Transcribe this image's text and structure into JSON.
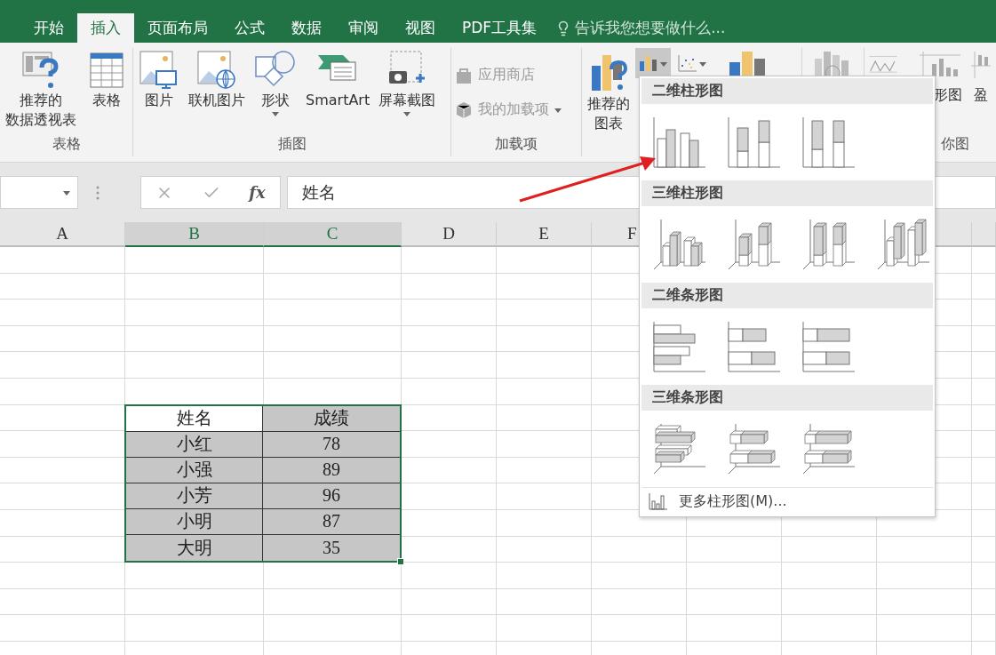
{
  "tabs": [
    {
      "label": "开始",
      "selected": false
    },
    {
      "label": "插入",
      "selected": true
    },
    {
      "label": "页面布局",
      "selected": false
    },
    {
      "label": "公式",
      "selected": false
    },
    {
      "label": "数据",
      "selected": false
    },
    {
      "label": "审阅",
      "selected": false
    },
    {
      "label": "视图",
      "selected": false
    },
    {
      "label": "PDF工具集",
      "selected": false
    }
  ],
  "tell_me": {
    "placeholder": "告诉我您想要做什么..."
  },
  "ribbon": {
    "groups": [
      {
        "label": "表格",
        "kind": "large",
        "buttons": [
          {
            "lines": [
              "推荐的",
              "数据透视表"
            ],
            "dropdown": false
          },
          {
            "lines": [
              "表格"
            ],
            "dropdown": false
          }
        ]
      },
      {
        "label": "插图",
        "kind": "large",
        "buttons": [
          {
            "lines": [
              "图片"
            ],
            "dropdown": false
          },
          {
            "lines": [
              "联机图片"
            ],
            "dropdown": false
          },
          {
            "lines": [
              "形状"
            ],
            "dropdown": true
          },
          {
            "lines": [
              "SmartArt"
            ],
            "dropdown": false
          },
          {
            "lines": [
              "屏幕截图"
            ],
            "dropdown": true
          }
        ]
      },
      {
        "label": "加载项",
        "kind": "small",
        "buttons": [
          {
            "label": "应用商店",
            "disabled": true,
            "dropdown": false
          },
          {
            "label": "我的加载项",
            "disabled": true,
            "dropdown": true
          }
        ]
      }
    ],
    "charts": {
      "recommended": {
        "lines": [
          "推荐的",
          "图表"
        ]
      },
      "gallery_buttons": [
        {
          "selected": true,
          "dropdown": true
        },
        {
          "selected": false,
          "dropdown": true
        }
      ]
    },
    "sparklines": {
      "labels": [
        "形图",
        "盈"
      ],
      "group_label": "你图"
    }
  },
  "formula_bar": {
    "function_label": "fx",
    "formula": "姓名"
  },
  "columns": [
    {
      "label": "A",
      "selected": false
    },
    {
      "label": "B",
      "selected": true
    },
    {
      "label": "C",
      "selected": true
    },
    {
      "label": "D",
      "selected": false
    },
    {
      "label": "E",
      "selected": false
    },
    {
      "label": "F",
      "selected": false
    }
  ],
  "table": {
    "columns": [
      {
        "text": "姓名",
        "active": true
      },
      {
        "text": "成绩",
        "active": false
      }
    ],
    "rows": [
      [
        "小红",
        "78"
      ],
      [
        "小强",
        "89"
      ],
      [
        "小芳",
        "96"
      ],
      [
        "小明",
        "87"
      ],
      [
        "大明",
        "35"
      ]
    ]
  },
  "chart_menu": {
    "sections": [
      {
        "title": "二维柱形图",
        "kind": "column2d"
      },
      {
        "title": "三维柱形图",
        "kind": "column3d"
      },
      {
        "title": "二维条形图",
        "kind": "bar2d"
      },
      {
        "title": "三维条形图",
        "kind": "bar3d"
      }
    ],
    "more": "更多柱形图(M)..."
  }
}
